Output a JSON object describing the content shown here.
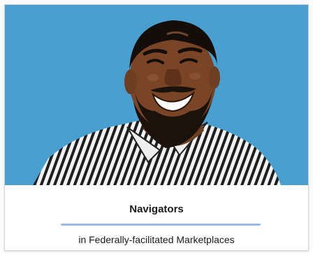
{
  "card": {
    "title": "Navigators",
    "subtitle": "in Federally-facilitated Marketplaces",
    "image_alt_name": "smiling-man-portrait"
  },
  "colors": {
    "photo_background": "#4a9fd1",
    "divider": "#9bb9e3",
    "text": "#1a1a1a"
  }
}
